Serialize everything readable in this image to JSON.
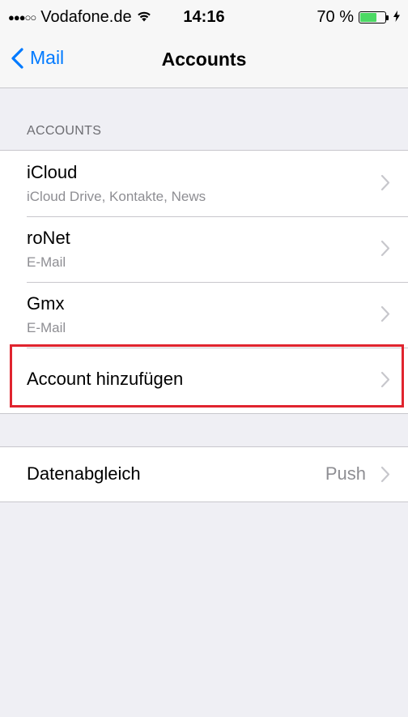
{
  "status_bar": {
    "signal": "●●●○○",
    "carrier": "Vodafone.de",
    "time": "14:16",
    "battery_percent": "70 %",
    "battery_level": 0.7,
    "wifi_icon": "wifi-icon",
    "charging_icon": "bolt-icon"
  },
  "nav": {
    "back_label": "Mail",
    "title": "Accounts"
  },
  "accounts_section": {
    "header": "ACCOUNTS",
    "items": [
      {
        "title": "iCloud",
        "subtitle": "iCloud Drive, Kontakte, News"
      },
      {
        "title": "roNet",
        "subtitle": "E-Mail"
      },
      {
        "title": "Gmx",
        "subtitle": "E-Mail"
      },
      {
        "title": "Account hinzufügen"
      }
    ]
  },
  "sync_section": {
    "title": "Datenabgleich",
    "value": "Push"
  },
  "colors": {
    "accent": "#007aff",
    "highlight": "#e0242e",
    "background": "#efeff4",
    "battery": "#4cd964"
  }
}
